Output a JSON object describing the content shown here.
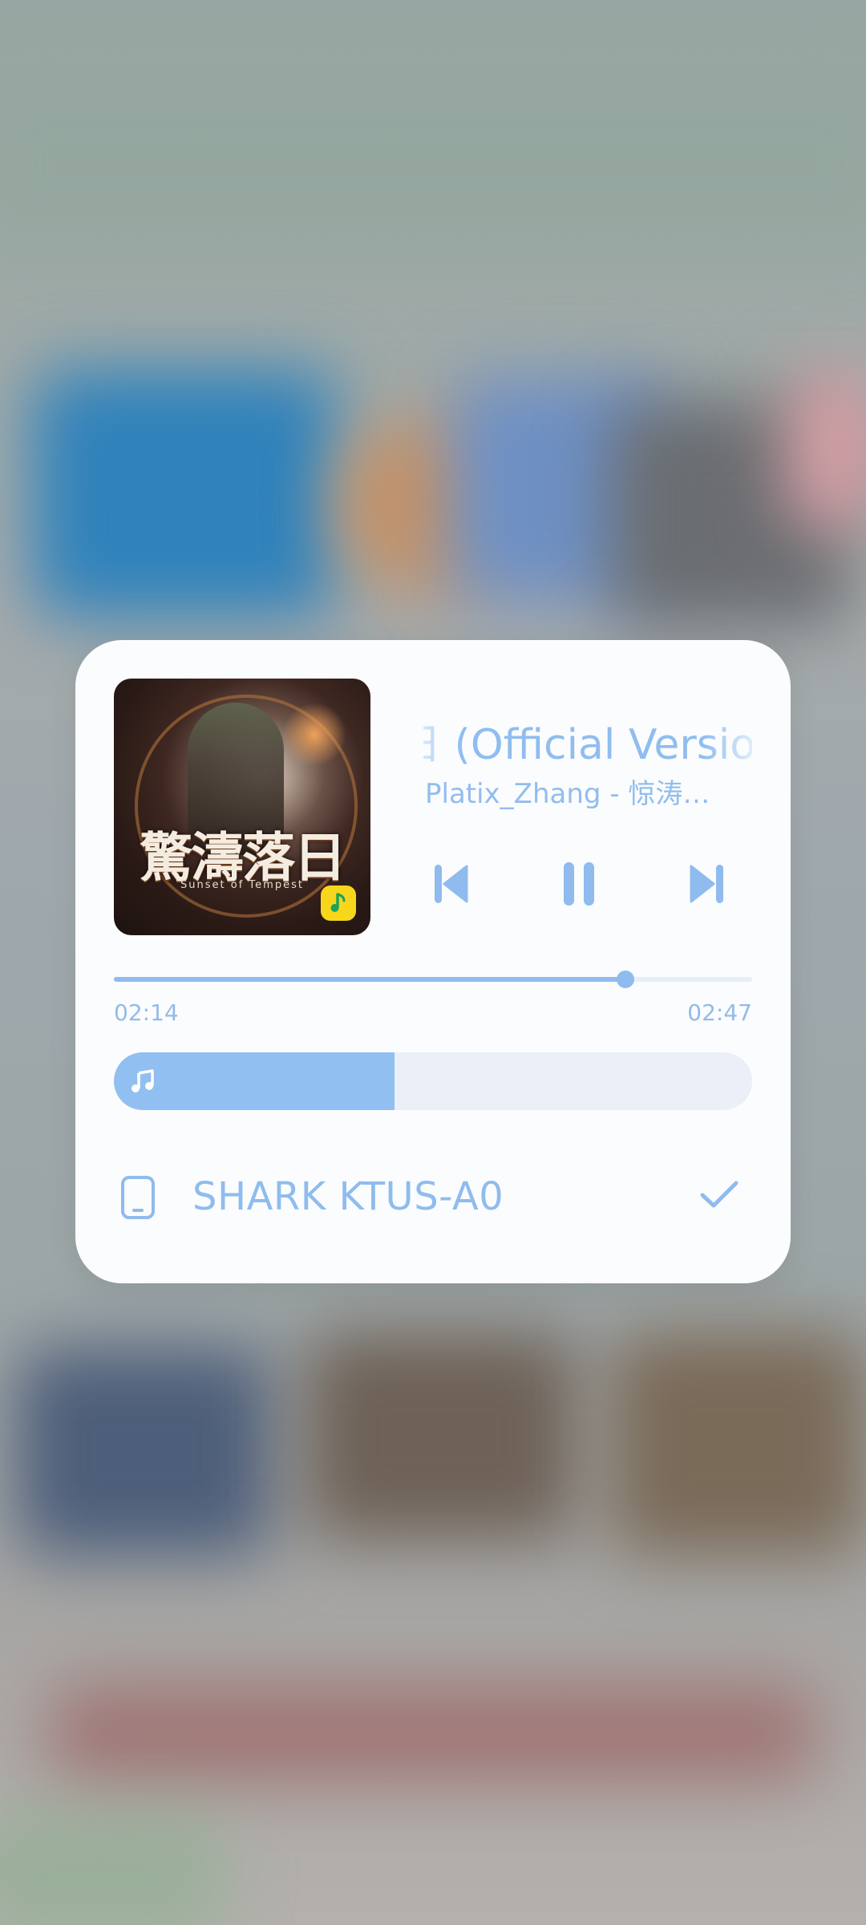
{
  "now_playing": {
    "title": "日 (Official Version)",
    "artist": "Platix_Zhang - 惊涛…",
    "cover_title": "驚濤落日",
    "cover_subtitle": "Sunset of Tempest",
    "app_badge_icon": "qq-music-icon"
  },
  "controls": {
    "previous_icon": "skip-previous-icon",
    "pause_icon": "pause-icon",
    "next_icon": "skip-next-icon"
  },
  "progress": {
    "elapsed": "02:14",
    "total": "02:47",
    "fraction": 0.802
  },
  "volume": {
    "icon": "music-note-icon",
    "fraction": 0.44
  },
  "output_device": {
    "name": "SHARK KTUS-A0",
    "icon": "phone-icon",
    "selected": true,
    "selected_icon": "check-icon"
  },
  "colors": {
    "accent": "#8fbbee",
    "card_background": "#fbfcfd",
    "track_background": "#eaeff8"
  }
}
